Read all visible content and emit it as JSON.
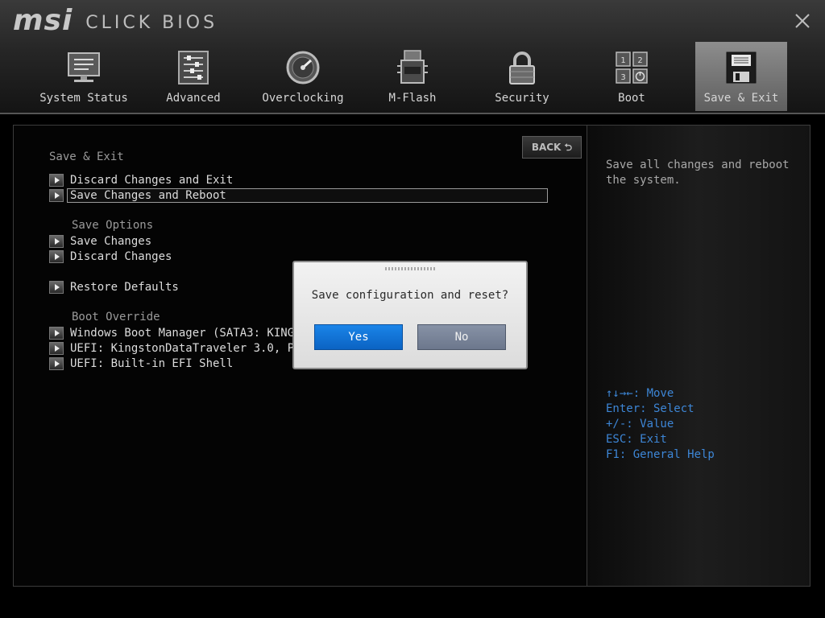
{
  "brand": {
    "logo": "msi",
    "product": "CLICK BIOS"
  },
  "colors": {
    "accent_blue": "#0b6fd6",
    "help_blue": "#3d86d6",
    "no_button": "#76819a"
  },
  "tabs": [
    {
      "label": "System Status",
      "icon": "monitor-icon"
    },
    {
      "label": "Advanced",
      "icon": "sliders-icon"
    },
    {
      "label": "Overclocking",
      "icon": "gauge-icon"
    },
    {
      "label": "M-Flash",
      "icon": "bios-chip-icon"
    },
    {
      "label": "Security",
      "icon": "padlock-icon"
    },
    {
      "label": "Boot",
      "icon": "boot-keys-icon"
    },
    {
      "label": "Save & Exit",
      "icon": "floppy-disk-icon",
      "active": true
    }
  ],
  "main": {
    "back_label": "BACK",
    "section_save_exit": "Save & Exit",
    "items": {
      "discard_exit": "Discard Changes and Exit",
      "save_reboot": "Save Changes and Reboot"
    },
    "section_save_options": "Save Options",
    "save_options": {
      "save_changes": "Save Changes",
      "discard_changes": "Discard Changes"
    },
    "restore_defaults": "Restore Defaults",
    "section_boot_override": "Boot Override",
    "boot_override": {
      "windows": "Windows Boot Manager (SATA3: KINGST",
      "uefi_usb": "UEFI: KingstonDataTraveler 3.0, Pa",
      "uefi_shell": "UEFI: Built-in EFI Shell"
    }
  },
  "help": {
    "description": "Save all changes and reboot the system.",
    "keys": {
      "move": "↑↓→←: Move",
      "select": "Enter: Select",
      "value": "+/-: Value",
      "exit": "ESC: Exit",
      "general": "F1: General Help"
    }
  },
  "dialog": {
    "message": "Save configuration and reset?",
    "yes": "Yes",
    "no": "No"
  }
}
